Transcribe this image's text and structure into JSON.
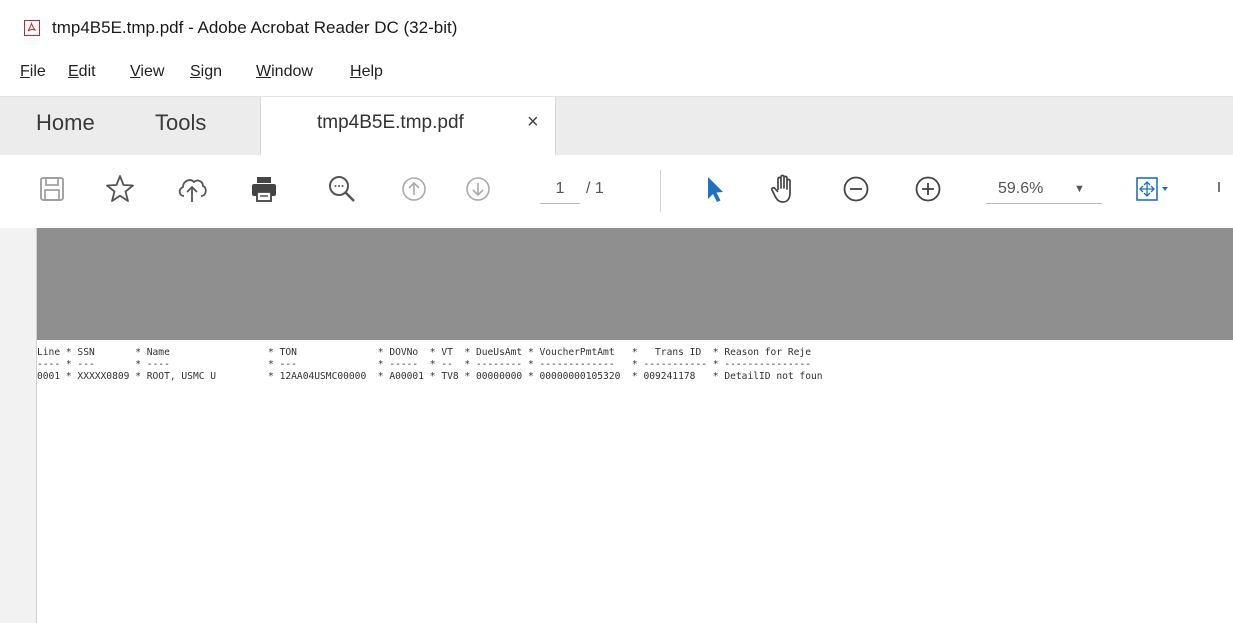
{
  "window": {
    "title": "tmp4B5E.tmp.pdf - Adobe Acrobat Reader DC (32-bit)"
  },
  "menu": {
    "items": [
      {
        "acc": "F",
        "rest": "ile"
      },
      {
        "acc": "E",
        "rest": "dit"
      },
      {
        "acc": "V",
        "rest": "iew"
      },
      {
        "acc": "S",
        "rest": "ign"
      },
      {
        "acc": "W",
        "rest": "indow"
      },
      {
        "acc": "H",
        "rest": "elp"
      }
    ]
  },
  "tabs": {
    "home": "Home",
    "tools": "Tools",
    "document": "tmp4B5E.tmp.pdf",
    "close": "×"
  },
  "toolbar": {
    "page_current": "1",
    "page_total": "/ 1",
    "zoom": "59.6%",
    "zoom_dropdown": "▼"
  },
  "document": {
    "lines": [
      "Line * SSN       * Name                 * TON              * DOVNo  * VT  * DueUsAmt * VoucherPmtAmt   *   Trans ID  * Reason for Reje",
      "---- * ---       * ----                 * ---              * -----  * --  * -------- * -------------   * ----------- * ---------------",
      "0001 * XXXXX0809 * ROOT, USMC U         * 12AA04USMC00000  * A00001 * TV8 * 00000000 * 00000000105320  * 009241178   * DetailID not foun"
    ]
  },
  "colors": {
    "accent_red": "#c4262e",
    "select_blue": "#1f6fc5"
  }
}
